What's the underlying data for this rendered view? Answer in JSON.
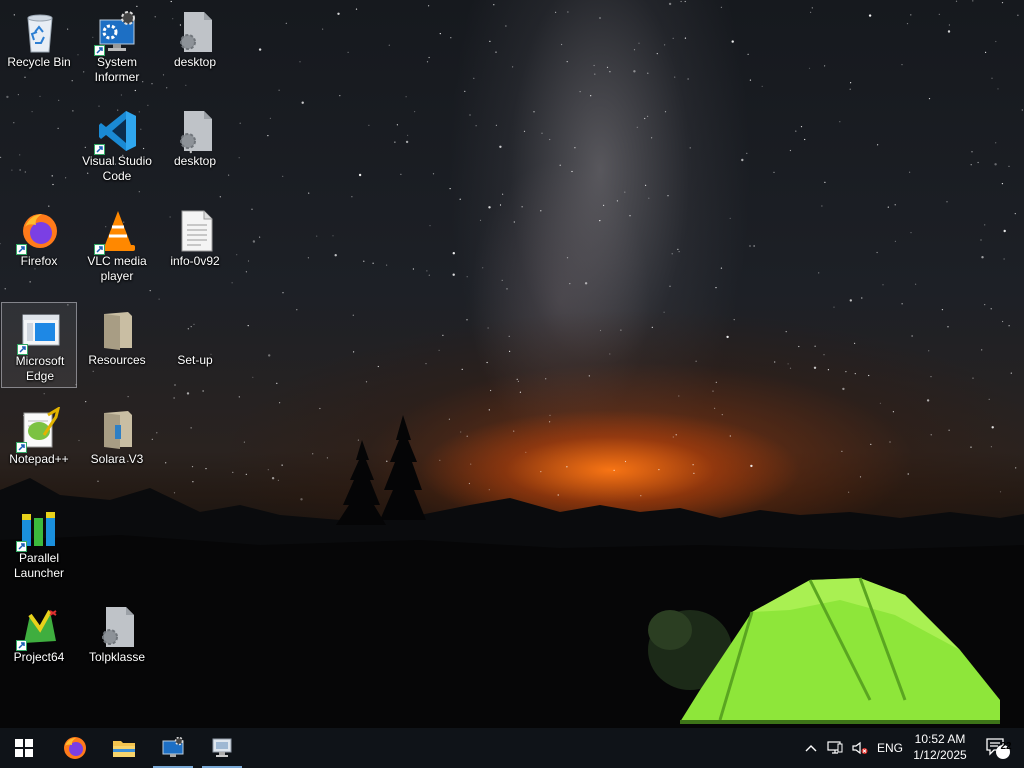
{
  "desktop": {
    "icons": [
      {
        "label": "Recycle Bin",
        "icon": "recycle-bin-icon"
      },
      {
        "label": "System Informer",
        "icon": "system-informer-icon"
      },
      {
        "label": "desktop",
        "icon": "settings-file-icon"
      },
      {
        "label": "Visual Studio Code",
        "icon": "vscode-icon"
      },
      {
        "label": "desktop",
        "icon": "settings-file-icon"
      },
      {
        "label": "Firefox",
        "icon": "firefox-icon"
      },
      {
        "label": "VLC media player",
        "icon": "vlc-icon"
      },
      {
        "label": "info-0v92",
        "icon": "text-file-icon"
      },
      {
        "label": "Microsoft Edge",
        "icon": "edge-icon"
      },
      {
        "label": "Resources",
        "icon": "folder-icon"
      },
      {
        "label": "Set-up",
        "icon": "blank-icon"
      },
      {
        "label": "Notepad++",
        "icon": "notepadpp-icon"
      },
      {
        "label": "Solara V3",
        "icon": "folder-icon"
      },
      {
        "label": "Parallel Launcher",
        "icon": "parallel-launcher-icon"
      },
      {
        "label": "Project64",
        "icon": "project64-icon"
      },
      {
        "label": "Tolpklasse",
        "icon": "settings-file-icon"
      }
    ],
    "selected_icon": "Microsoft Edge"
  },
  "taskbar": {
    "start_icon": "windows-start-icon",
    "pinned": [
      {
        "name": "Firefox",
        "icon": "firefox-icon"
      },
      {
        "name": "File Explorer",
        "icon": "folder-icon"
      },
      {
        "name": "System Informer",
        "icon": "system-informer-icon"
      },
      {
        "name": "Remote Desktop",
        "icon": "remote-desktop-icon"
      }
    ],
    "tray": {
      "language": "ENG",
      "time": "10:52 AM",
      "date": "1/12/2025",
      "notification_count": "22"
    }
  },
  "colors": {
    "taskbar_bg": "#0f1318",
    "accent": "#7aa9d6",
    "tent_green": "#8ee63a"
  }
}
